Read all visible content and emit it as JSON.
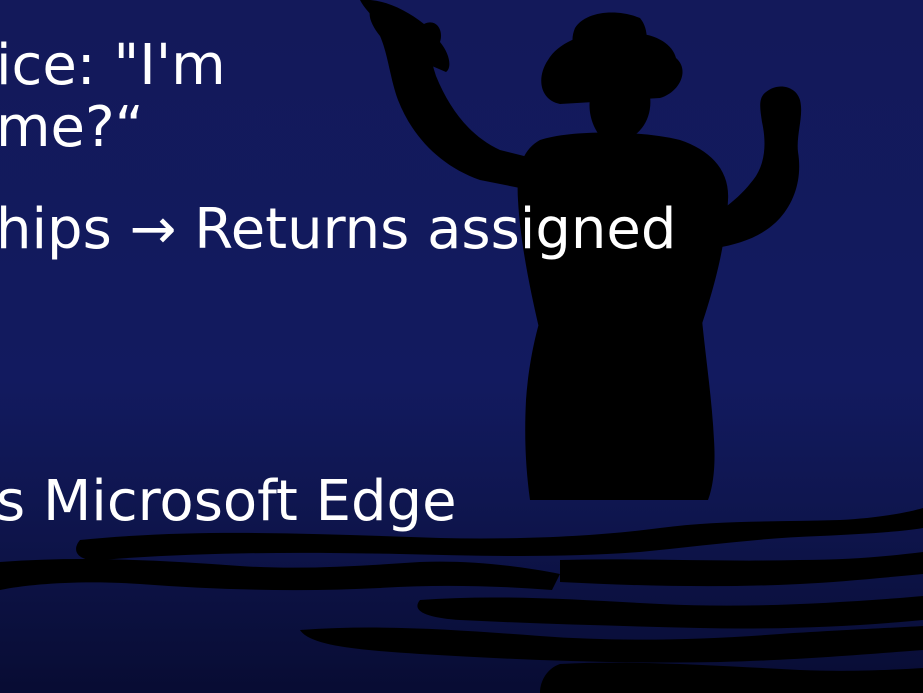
{
  "slide": {
    "lines": [
      "ice: \"I'm",
      "me?“",
      "hips → Returns assigned",
      "s Microsoft Edge"
    ]
  },
  "colors": {
    "background_top": "#13195a",
    "background_bottom": "#080c33",
    "silhouette": "#000000",
    "text": "#ffffff"
  },
  "decoration": {
    "image": "silhouette-person-waving-standing-in-water"
  }
}
